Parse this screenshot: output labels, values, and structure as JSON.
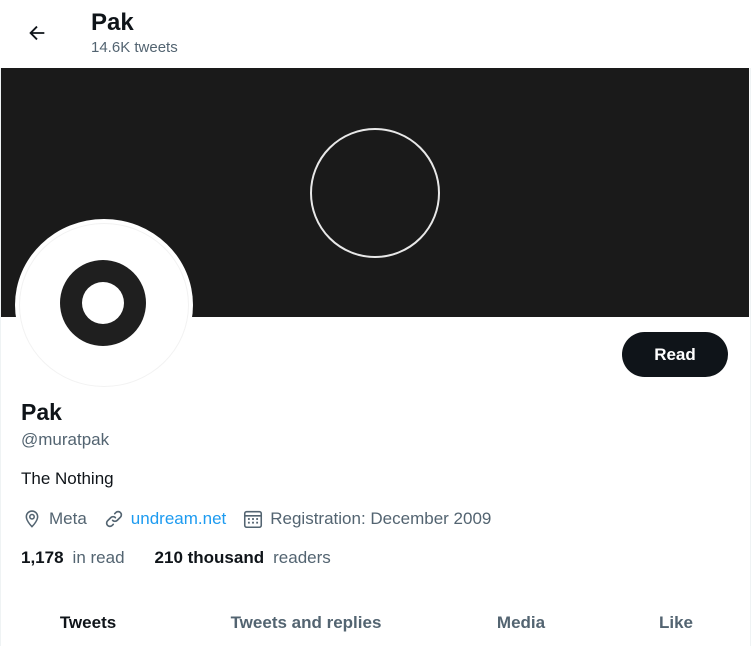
{
  "header": {
    "title": "Pak",
    "subtitle": "14.6K tweets",
    "back_icon": "arrow-left-icon"
  },
  "profile": {
    "name": "Pak",
    "handle": "@muratpak",
    "bio": "The Nothing",
    "read_button": "Read",
    "location": "Meta",
    "website": "undream.net",
    "registration": "Registration: December 2009",
    "following_count": "1,178",
    "following_label": "in read",
    "followers_count": "210 thousand",
    "followers_label": "readers"
  },
  "tabs": [
    {
      "label": "Tweets",
      "active": true
    },
    {
      "label": "Tweets and replies",
      "active": false
    },
    {
      "label": "Media",
      "active": false
    },
    {
      "label": "Like",
      "active": false
    }
  ],
  "colors": {
    "accent": "#1d9bf0",
    "banner": "#1a1a1a",
    "text": "#0f1419",
    "muted": "#536471"
  }
}
